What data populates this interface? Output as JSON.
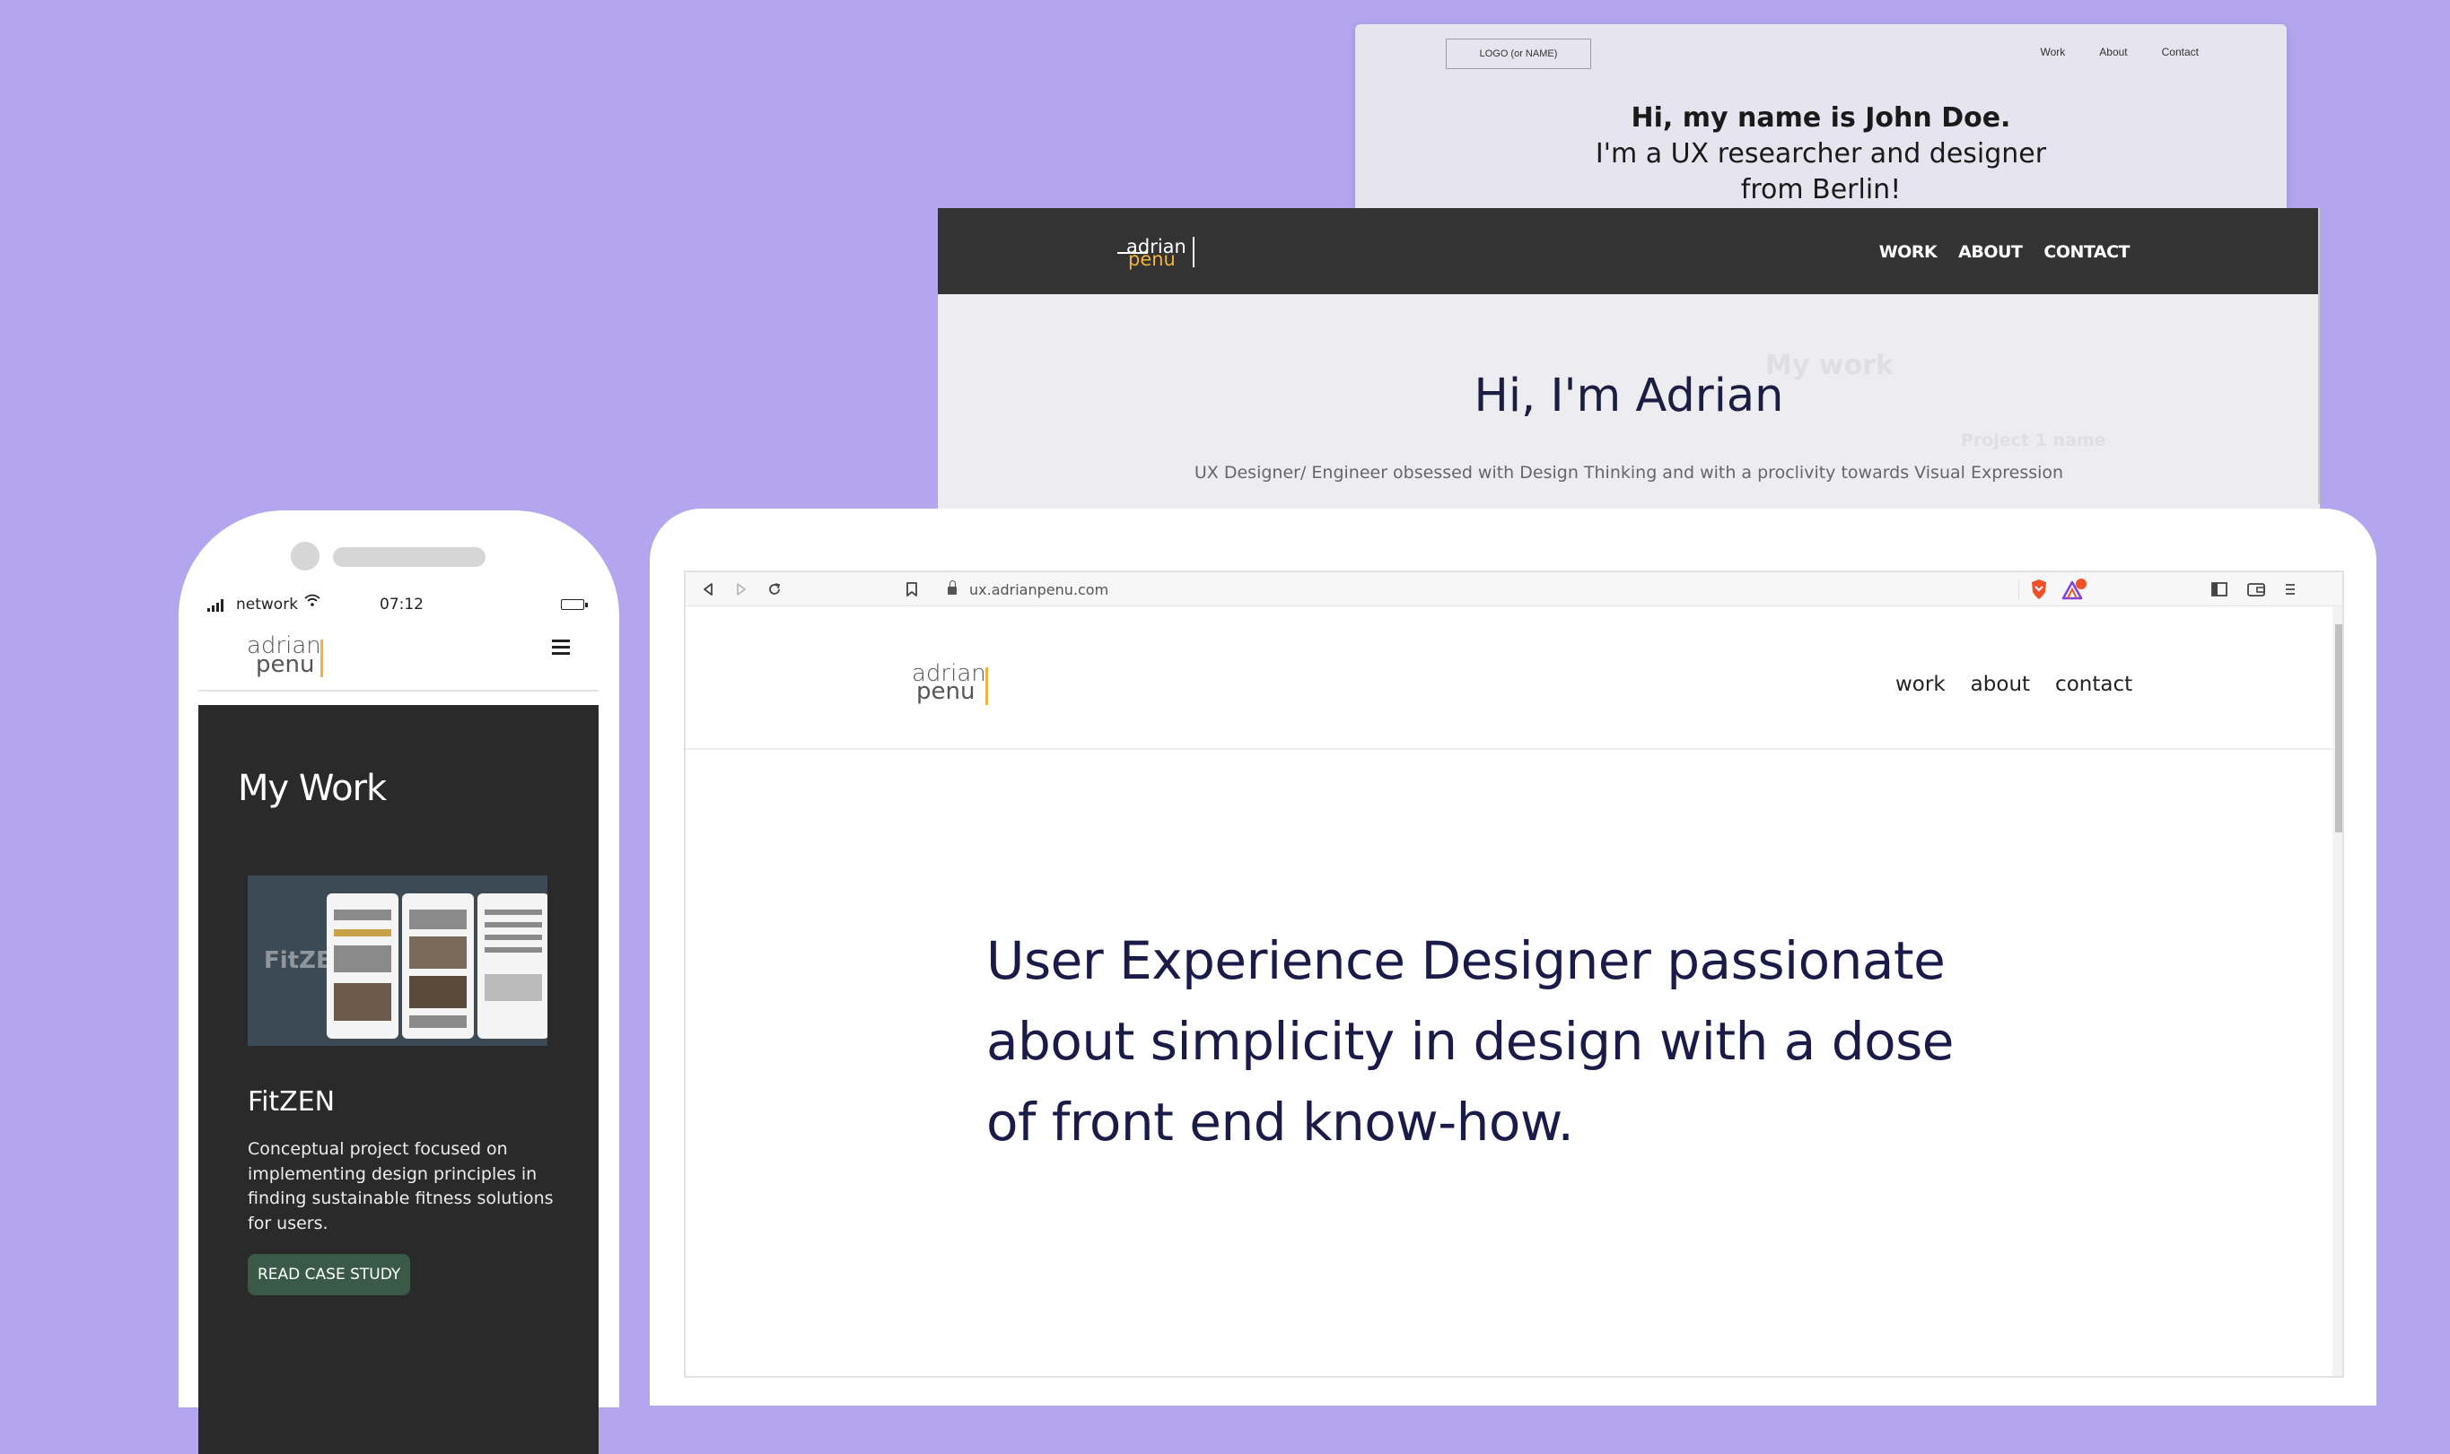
{
  "wireframe": {
    "logo": "LOGO (or NAME)",
    "nav": [
      "Work",
      "About",
      "Contact"
    ],
    "hero_bold": "Hi, my name is John Doe.",
    "hero_text": "I'm a UX researcher and designer from Berlin!",
    "ghost_heading": "My work",
    "ghost_project": "Project 1 name"
  },
  "dark_site": {
    "logo_line1": "adrian",
    "logo_line2": "penu",
    "nav": [
      "WORK",
      "ABOUT",
      "CONTACT"
    ],
    "hero": "Hi, I'm Adrian",
    "subtitle": "UX Designer/ Engineer obsessed with Design Thinking and with a proclivity towards Visual Expression"
  },
  "phone": {
    "status": {
      "network": "network",
      "time": "07:12"
    },
    "logo_line1": "adrian",
    "logo_line2": "penu",
    "section_title": "My Work",
    "project": {
      "thumbnail_brand": "FitZEN",
      "name": "FitZEN",
      "description": "Conceptual project focused on implementing design principles in finding sustainable fitness solutions for users.",
      "button": "READ CASE STUDY"
    }
  },
  "browser": {
    "url": "ux.adrianpenu.com",
    "icons": [
      "back-icon",
      "forward-icon",
      "reload-icon",
      "bookmark-icon",
      "lock-icon",
      "brave-shield-icon",
      "brave-rewards-icon",
      "sidebar-icon",
      "wallet-icon",
      "menu-icon"
    ],
    "site": {
      "logo_line1": "adrian",
      "logo_line2": "penu",
      "nav": [
        "work",
        "about",
        "contact"
      ],
      "hero": "User Experience Designer passionate about simplicity in design with a dose of front end know-how."
    }
  },
  "colors": {
    "background": "#b4a6ee",
    "accent": "#f4b43a",
    "hero_text": "#1a1b48",
    "dark_header": "#333333",
    "button_green": "#3a5a47"
  }
}
